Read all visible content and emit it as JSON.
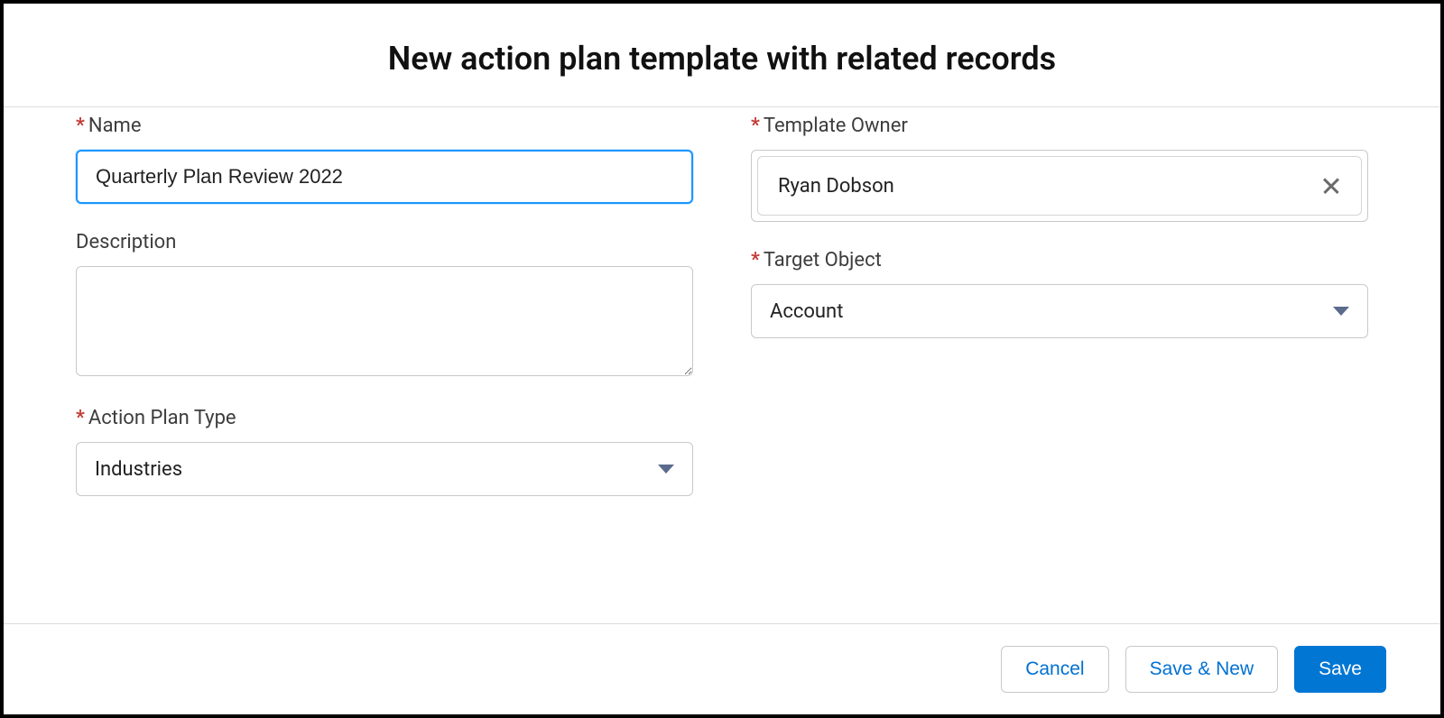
{
  "header": {
    "title": "New action plan template with related records"
  },
  "fields": {
    "name": {
      "label": "Name",
      "required": true,
      "value": "Quarterly Plan Review 2022"
    },
    "description": {
      "label": "Description",
      "required": false,
      "value": ""
    },
    "actionPlanType": {
      "label": "Action Plan Type",
      "required": true,
      "value": "Industries"
    },
    "templateOwner": {
      "label": "Template Owner",
      "required": true,
      "value": "Ryan Dobson"
    },
    "targetObject": {
      "label": "Target Object",
      "required": true,
      "value": "Account"
    }
  },
  "footer": {
    "cancel": "Cancel",
    "saveAndNew": "Save & New",
    "save": "Save"
  },
  "requiredMarker": "*"
}
